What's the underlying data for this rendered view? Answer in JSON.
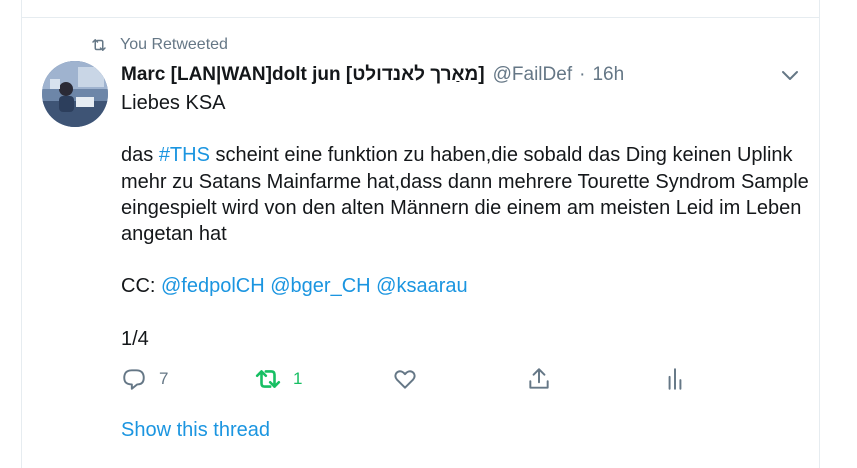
{
  "retweet": {
    "label": "You Retweeted"
  },
  "tweet": {
    "name": "Marc [LAN|WAN]dolt jun [מאַרך לאנדולט]",
    "handle": "@FailDef",
    "separator": "·",
    "time": "16h",
    "lines": {
      "l1": "Liebes KSA",
      "l2_prefix": "das ",
      "l2_hashtag": "#THS",
      "l2_text": " scheint eine funktion zu haben,die sobald das Ding keinen Uplink mehr zu Satans Mainfarme hat,dass dann mehrere Tourette Syndrom Sample eingespielt wird von den alten Männern die einem am meisten Leid im Leben angetan hat",
      "cc_label": "CC: ",
      "mention1": "@fedpolCH",
      "mention2": "@bger_CH",
      "mention3": "@ksaarau",
      "count": "1/4"
    }
  },
  "actions": {
    "reply_count": "7",
    "retweet_count": "1"
  },
  "show_thread": "Show this thread",
  "colors": {
    "link": "#1b95e0",
    "retweet": "#17bf63",
    "muted": "#657786"
  },
  "icons": [
    "retweet-icon",
    "chevron-down-icon",
    "reply-icon",
    "retweet-icon",
    "like-icon",
    "share-icon",
    "analytics-icon"
  ]
}
